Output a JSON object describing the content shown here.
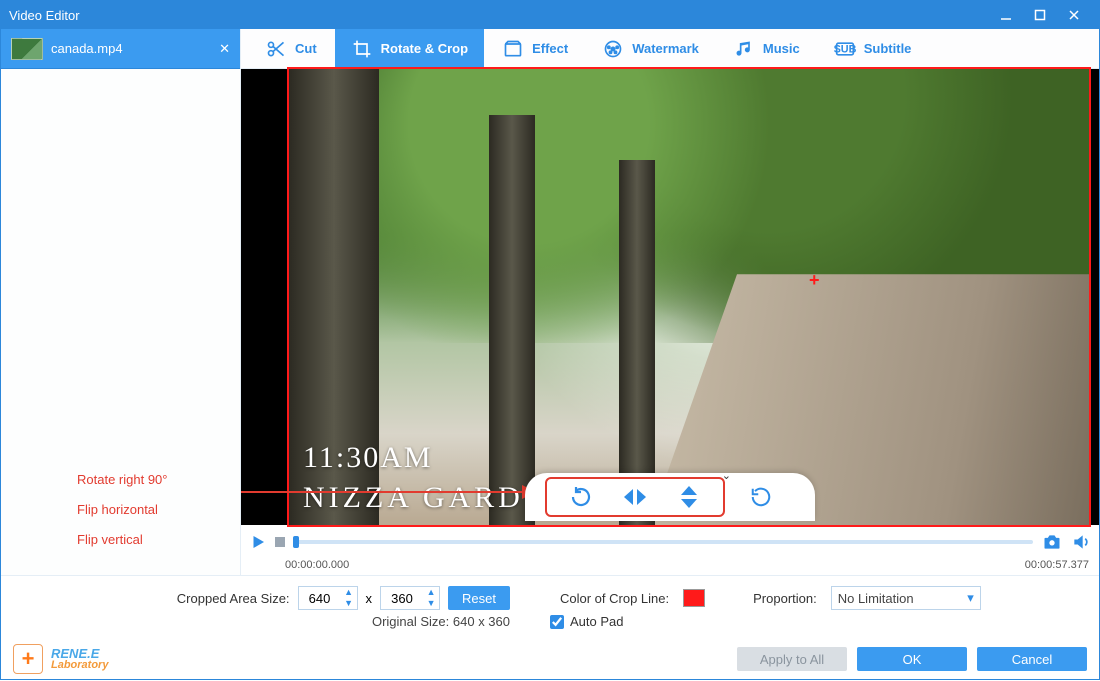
{
  "window": {
    "title": "Video Editor"
  },
  "file": {
    "name": "canada.mp4"
  },
  "tabs": {
    "cut": "Cut",
    "rotate_crop": "Rotate & Crop",
    "effect": "Effect",
    "watermark": "Watermark",
    "music": "Music",
    "subtitle": "Subtitle"
  },
  "overlay": {
    "time_label": "11:30AM",
    "place_label": "NIZZA GARD"
  },
  "annotations": {
    "rotate": "Rotate right 90°",
    "fliph": "Flip horizontal",
    "flipv": "Flip vertical"
  },
  "playback": {
    "current": "00:00:00.000",
    "total": "00:00:57.377"
  },
  "crop": {
    "size_label": "Cropped Area Size:",
    "w": "640",
    "h": "360",
    "sep": "x",
    "reset": "Reset",
    "original_label": "Original Size: 640 x 360",
    "color_label": "Color of Crop Line:",
    "color": "#ff1a1a",
    "proportion_label": "Proportion:",
    "proportion_value": "No Limitation",
    "autopad_label": "Auto Pad"
  },
  "footer": {
    "brand_top": "RENE.E",
    "brand_bottom": "Laboratory",
    "apply_all": "Apply to All",
    "ok": "OK",
    "cancel": "Cancel"
  }
}
